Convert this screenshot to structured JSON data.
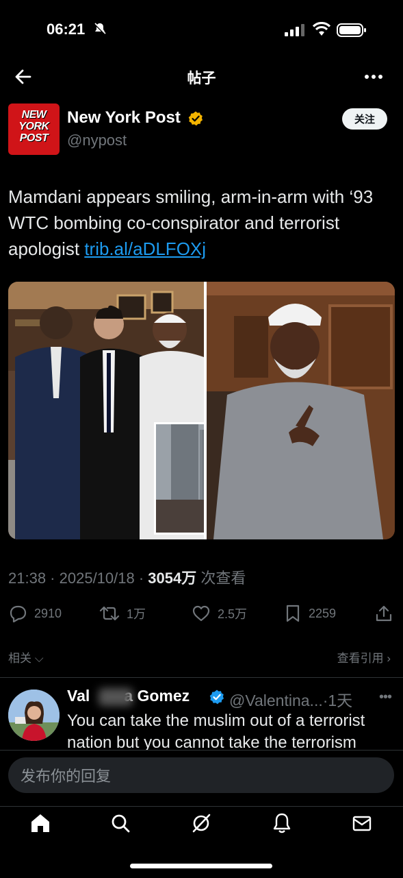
{
  "status_bar": {
    "time": "06:21"
  },
  "header": {
    "title": "帖子"
  },
  "post": {
    "author_name": "New York Post",
    "author_handle": "@nypost",
    "avatar_lines": [
      "NEW",
      "YORK",
      "POST"
    ],
    "follow_label": "关注",
    "text": "Mamdani appears smiling, arm-in-arm with ‘93 WTC bombing co-conspirator and terrorist apologist ",
    "link": "trib.al/aDLFOXj",
    "time": "21:38",
    "date": "2025/10/18",
    "views": "3054万",
    "views_label": "次查看",
    "replies": "2910",
    "retweets": "1万",
    "likes": "2.5万",
    "bookmarks": "2259"
  },
  "related": {
    "label": "相关",
    "quotes_label": "查看引用"
  },
  "reply": {
    "author_start": "Val",
    "author_end": "a Gomez",
    "handle": "@Valentina...",
    "time": "·1天",
    "text": "You can take the muslim out of a terrorist nation but you cannot take the terrorism"
  },
  "composer": {
    "placeholder": "发布你的回复"
  },
  "colors": {
    "accent": "#1d9bf0",
    "verified": "#f4b400",
    "brand": "#d01418"
  }
}
